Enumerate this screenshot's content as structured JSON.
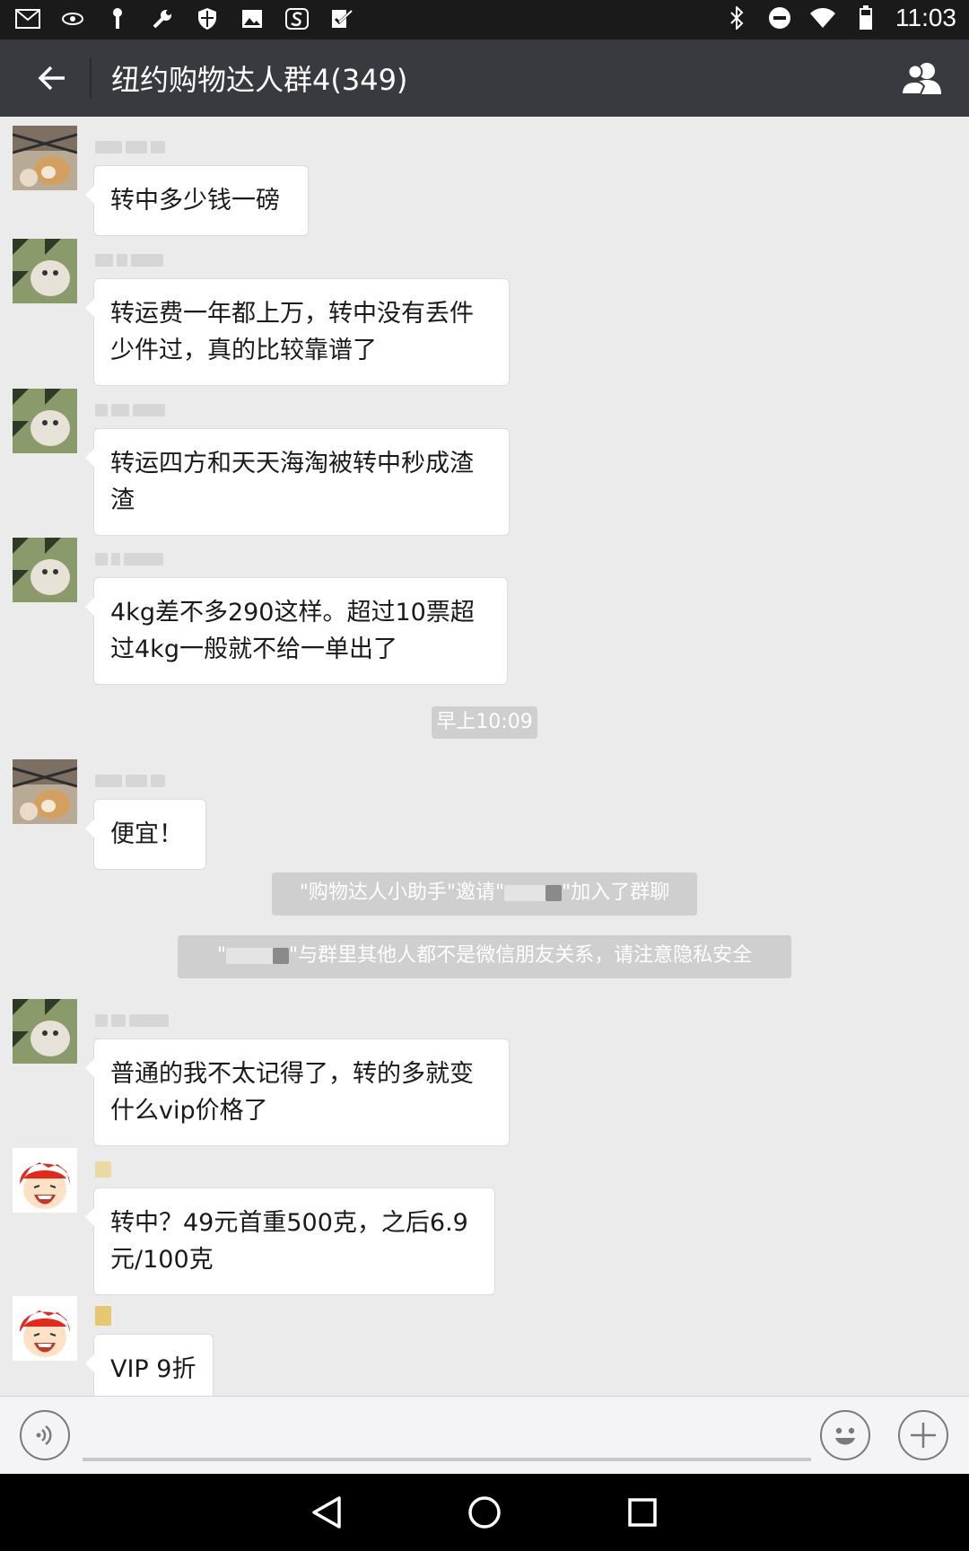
{
  "status_bar": {
    "time": "11:03",
    "left_icons": [
      "gmail-icon",
      "eye-icon",
      "usb-icon",
      "wrench-icon",
      "shield-icon",
      "image-icon",
      "s-app-icon",
      "checkbox-icon"
    ],
    "right_icons": [
      "bluetooth-icon",
      "do-not-disturb-icon",
      "wifi-icon",
      "battery-icon"
    ]
  },
  "header": {
    "title": "纽约购物达人群4(349)",
    "back_icon": "back-arrow-icon",
    "group_icon": "group-members-icon"
  },
  "messages": [
    {
      "text": "转中多少钱一磅",
      "avatar": "avatar-dog"
    },
    {
      "text": "转运费一年都上万，转中没有丢件少件过，真的比较靠谱了",
      "avatar": "avatar-cat"
    },
    {
      "text": "转运四方和天天海淘被转中秒成渣渣",
      "avatar": "avatar-cat"
    },
    {
      "text": "4kg差不多290这样。超过10票超过4kg一般就不给一单出了",
      "avatar": "avatar-cat"
    },
    {
      "text": "便宜！",
      "avatar": "avatar-dog"
    },
    {
      "text": "普通的我不太记得了，转的多就变什么vip价格了",
      "avatar": "avatar-cat"
    },
    {
      "text": "转中？49元首重500克，之后6.9元/100克",
      "avatar": "avatar-cartoon"
    },
    {
      "text": "VIP 9折",
      "avatar": "avatar-cartoon"
    }
  ],
  "system": {
    "timestamp": "早上10:09",
    "invite_prefix": "\"购物达人小助手\"邀请\"",
    "invite_suffix": "\"加入了群聊",
    "privacy_suffix": "\"与群里其他人都不是微信朋友关系，请注意隐私安全",
    "quote": "\""
  },
  "input_bar": {
    "voice_icon": "voice-icon",
    "emoji_icon": "emoji-icon",
    "plus_icon": "plus-icon",
    "placeholder": ""
  },
  "nav_bar": {
    "back": "nav-back-icon",
    "home": "nav-home-icon",
    "recents": "nav-recents-icon"
  },
  "colors": {
    "header_bg": "#393a3f",
    "chat_bg": "#ebebeb",
    "bubble_bg": "#ffffff",
    "system_bg": "#cfcfcf"
  }
}
